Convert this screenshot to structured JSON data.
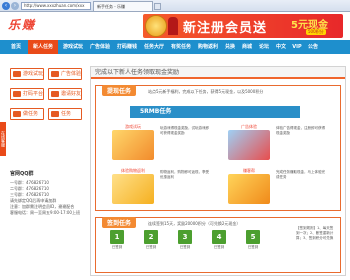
{
  "browser": {
    "back": "‹",
    "forward": "›",
    "address": "http://www.xxxzhuan.com/xxx",
    "tab_title": "新手任务 - 乐赚"
  },
  "logo": "乐赚",
  "banner": {
    "text": "新注册会员送",
    "amount": "5元现金",
    "badge": "500积分"
  },
  "nav": [
    {
      "label": "首页",
      "active": false
    },
    {
      "label": "新人任务",
      "active": true
    },
    {
      "label": "游戏试玩",
      "active": false
    },
    {
      "label": "广告体验",
      "active": false
    },
    {
      "label": "打码赚钱",
      "active": false
    },
    {
      "label": "任务大厅",
      "active": false
    },
    {
      "label": "有奖任务",
      "active": false
    },
    {
      "label": "购物返利",
      "active": false
    },
    {
      "label": "兑换",
      "active": false
    },
    {
      "label": "商城",
      "active": false
    },
    {
      "label": "论坛",
      "active": false
    },
    {
      "label": "中文",
      "active": false
    },
    {
      "label": "VIP",
      "active": false
    },
    {
      "label": "公告",
      "active": false
    }
  ],
  "side_buttons": [
    "游戏试玩",
    "广告体验",
    "打码平台",
    "邀请好友",
    "做任务",
    "任务"
  ],
  "side_tab": "在线客服",
  "qq": {
    "title": "官网QQ群",
    "lines": [
      "一号群：476826710",
      "二号群：476826710",
      "三号群：476826710",
      "请先绑定QQ后再申请加群",
      "注意：加群需注明会员ID，谢谢配合",
      "客服电话：周一至周五9:00-17:00上班"
    ]
  },
  "panel": {
    "header": "完成以下新人任务领取现金奖励",
    "section1": {
      "title": "提现任务",
      "desc": "站点5元新手福利，完成以下任务，获得5元现金，以及5000积分"
    },
    "srmb": "5RMB任务",
    "tasks": [
      {
        "name": "游戏试玩",
        "desc": "玩游戏得现金奖励，试玩游戏即可获得现金奖励"
      },
      {
        "name": "广告体验",
        "desc": "体验广告得现金，注册即可获得现金奖励"
      },
      {
        "name": "体验购物返利",
        "desc": "购物返利，购物即可返现，享受优惠返利"
      },
      {
        "name": "赚客帮",
        "desc": "完成任务赚取现金，马上体验完成任务"
      }
    ],
    "section2": {
      "title": "签到任务",
      "desc": "连续签到15天，奖励20000积分（可兑换2元现金）"
    },
    "days": [
      "1",
      "2",
      "3",
      "4",
      "5"
    ],
    "day_labels": [
      "已签到",
      "已签到",
      "已签到",
      "已签到",
      "已签到"
    ],
    "notes": "【签到规则】1、每天签到一次；2、断签重新计算；3、签到积分可兑换"
  },
  "colors": {
    "nav_bg": "#1e8fcd",
    "accent_orange": "#e94a19",
    "green": "#4c9f2f"
  }
}
